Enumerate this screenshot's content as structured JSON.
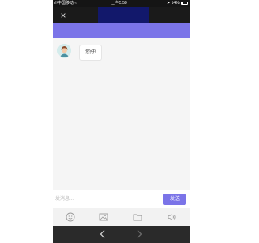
{
  "status_bar": {
    "carrier": "中国移动",
    "time": "上午5:59",
    "battery": "14%"
  },
  "header": {
    "close_icon": "×",
    "title": ""
  },
  "colors": {
    "accent": "#7b74e8",
    "header_block": "#12186b",
    "status_bar": "#151515",
    "bottom_nav": "#2a2a2a"
  },
  "chat": {
    "messages": [
      {
        "sender": "agent",
        "text": "您好!"
      }
    ]
  },
  "composer": {
    "placeholder": "发消息...",
    "send_label": "发送"
  },
  "toolbar": {
    "icons": [
      "emoji-icon",
      "image-icon",
      "folder-icon",
      "voice-icon"
    ]
  },
  "browser_nav": {
    "icons": [
      "back-arrow-icon",
      "forward-arrow-icon"
    ]
  }
}
